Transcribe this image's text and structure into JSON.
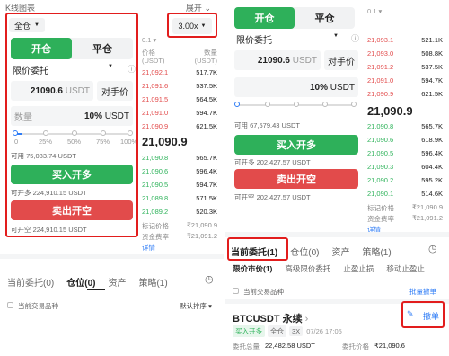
{
  "left": {
    "header_title": "K线图表",
    "expand_label": "展开",
    "margin_mode": "全仓",
    "leverage": "3.00x",
    "tab_open": "开仓",
    "tab_close": "平仓",
    "order_type": "限价委托",
    "price_value": "21090.6",
    "price_unit": "USDT",
    "opponent_price": "对手价",
    "qty_label": "数量",
    "qty_value": "10%",
    "qty_unit": "USDT",
    "slider_ticks": [
      "0",
      "25%",
      "50%",
      "75%",
      "100%"
    ],
    "available": "可用 75,083.74 USDT",
    "buy_label": "买入开多",
    "can_long": "可开多 224,910.15 USDT",
    "sell_label": "卖出开空",
    "can_short": "可开空 224,910.15 USDT",
    "ob_precision": "0.1",
    "ob_header_price": "价格",
    "ob_header_price_unit": "(USDT)",
    "ob_header_qty": "数量",
    "ob_header_qty_unit": "(USDT)",
    "asks": [
      {
        "p": "21,092.1",
        "q": "517.7K"
      },
      {
        "p": "21,091.6",
        "q": "537.5K"
      },
      {
        "p": "21,091.5",
        "q": "564.5K"
      },
      {
        "p": "21,091.0",
        "q": "594.7K"
      },
      {
        "p": "21,090.9",
        "q": "621.5K"
      }
    ],
    "mid_price": "21,090.9",
    "bids": [
      {
        "p": "21,090.8",
        "q": "565.7K"
      },
      {
        "p": "21,090.6",
        "q": "596.4K"
      },
      {
        "p": "21,090.5",
        "q": "594.7K"
      },
      {
        "p": "21,089.8",
        "q": "571.5K"
      },
      {
        "p": "21,089.2",
        "q": "520.3K"
      }
    ],
    "mark_label": "标记价格",
    "mark_value": "₹21,090.9",
    "fund_label": "资金费率",
    "fund_value": "₹21,091.2",
    "details": "详情",
    "bottom_tabs": [
      "当前委托(0)",
      "仓位(0)",
      "资产",
      "策略(1)"
    ],
    "filter_label": "当前交易品种",
    "sort_label": "默认排序"
  },
  "right": {
    "tab_open": "开仓",
    "tab_close": "平仓",
    "ob_precision": "0.1",
    "order_type": "限价委托",
    "price_value": "21090.6",
    "price_unit": "USDT",
    "opponent_price": "对手价",
    "qty_value": "10%",
    "qty_unit": "USDT",
    "available": "可用 67,579.43 USDT",
    "buy_label": "买入开多",
    "can_long": "可开多 202,427.57 USDT",
    "sell_label": "卖出开空",
    "can_short": "可开空 202,427.57 USDT",
    "asks": [
      {
        "p": "21,093.1",
        "q": "521.1K"
      },
      {
        "p": "21,093.0",
        "q": "508.8K"
      },
      {
        "p": "21,091.2",
        "q": "537.5K"
      },
      {
        "p": "21,091.0",
        "q": "594.7K"
      },
      {
        "p": "21,090.9",
        "q": "621.5K"
      }
    ],
    "mid_price": "21,090.9",
    "bids": [
      {
        "p": "21,090.8",
        "q": "565.7K"
      },
      {
        "p": "21,090.6",
        "q": "618.9K"
      },
      {
        "p": "21,090.5",
        "q": "596.4K"
      },
      {
        "p": "21,090.3",
        "q": "604.4K"
      },
      {
        "p": "21,090.2",
        "q": "595.2K"
      },
      {
        "p": "21,090.1",
        "q": "514.6K"
      }
    ],
    "mark_label": "标记价格",
    "mark_value": "₹21,090.9",
    "fund_label": "资金费率",
    "fund_value": "₹21,091.2",
    "details": "详情",
    "bottom_tabs": [
      "当前委托(1)",
      "仓位(0)",
      "资产",
      "策略(1)"
    ],
    "sub_tabs": [
      "限价市价(1)",
      "高级限价委托",
      "止盈止损",
      "移动止盈止"
    ],
    "filter_label": "当前交易品种",
    "batch_cancel": "批量撤单",
    "order_symbol": "BTCUSDT 永续",
    "order_side": "买入开多",
    "order_mode": "全仓",
    "order_lev": "3X",
    "order_time": "07/26 17:05",
    "cancel_label": "撤单",
    "order_total_label": "委托总量",
    "order_total_value": "22,482.58 USDT",
    "order_price_label": "委托价格",
    "order_price_value": "₹21,090.6"
  }
}
